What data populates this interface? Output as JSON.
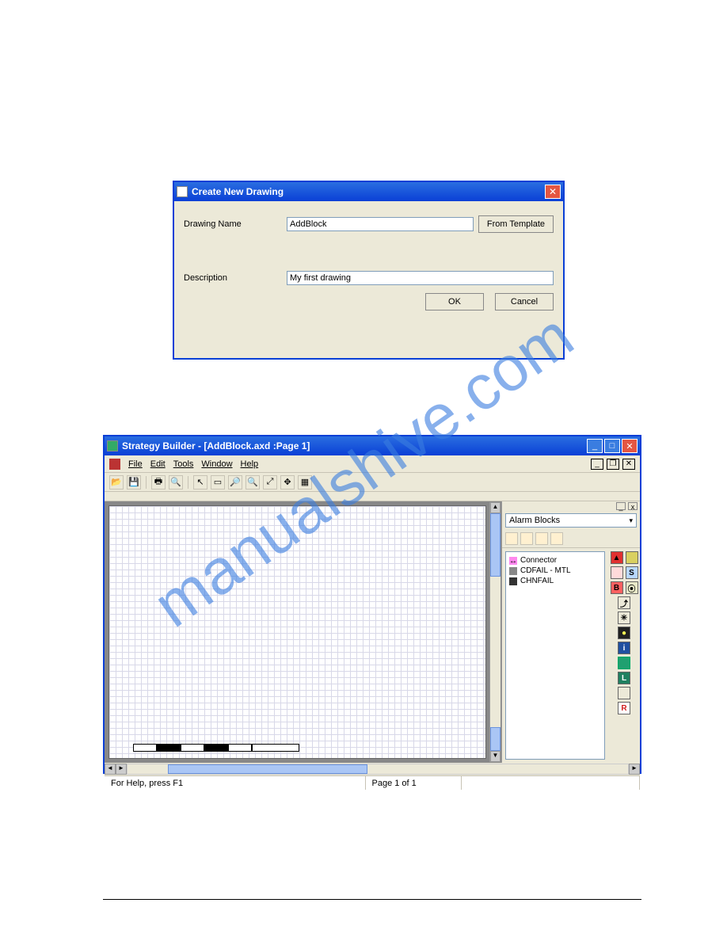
{
  "watermark": "manualshive.com",
  "dialog1": {
    "title": "Create New Drawing",
    "labels": {
      "drawing_name": "Drawing Name",
      "description": "Description"
    },
    "inputs": {
      "drawing_name": "AddBlock",
      "description": "My first drawing"
    },
    "buttons": {
      "from_template": "From Template",
      "ok": "OK",
      "cancel": "Cancel"
    }
  },
  "window2": {
    "title": "Strategy Builder  - [AddBlock.axd :Page 1]",
    "menu": [
      "File",
      "Edit",
      "Tools",
      "Window",
      "Help"
    ],
    "toolbar_icons": [
      "open-icon",
      "save-icon",
      "print-icon",
      "print-preview-icon",
      "pointer-icon",
      "rect-icon",
      "zoom-in-icon",
      "zoom-out-icon",
      "zoom-fit-icon",
      "pan-icon",
      "grid-icon"
    ],
    "panel": {
      "combo_label": "Alarm Blocks",
      "mini_icons": [
        "new-folder-icon",
        "open-folder-icon",
        "disk-icon",
        "disk2-icon"
      ],
      "tree": [
        {
          "icon": "connector-icon",
          "label": "Connector"
        },
        {
          "icon": "block-icon",
          "label": "CDFAIL - MTL"
        },
        {
          "icon": "block-icon",
          "label": "CHNFAIL"
        }
      ],
      "side_tools": {
        "row1": [
          {
            "label": "▲",
            "bg": "#e03030"
          },
          {
            "label": "",
            "bg": "#d9d060"
          }
        ],
        "row2": [
          {
            "label": "",
            "bg": "#ffdada"
          },
          {
            "label": "S",
            "bg": "#b8d8ff"
          }
        ],
        "row3": [
          {
            "label": "B",
            "bg": "#ff6060"
          },
          {
            "label": "⦿",
            "bg": "#e8e8c8"
          }
        ],
        "singles": [
          {
            "label": "⤴",
            "bg": "#ece9d8"
          },
          {
            "label": "✳",
            "bg": "#ece9d8"
          },
          {
            "label": "●",
            "bg": "#202020",
            "fg": "#ff5"
          },
          {
            "label": "i",
            "bg": "#2050a0",
            "fg": "#fff"
          },
          {
            "label": "",
            "bg": "#20a070",
            "border": "#0a6"
          },
          {
            "label": "L",
            "bg": "#208060",
            "fg": "#fff"
          },
          {
            "label": "",
            "bg": "#ece9d8"
          },
          {
            "label": "R",
            "bg": "#fff",
            "fg": "#d02020"
          }
        ]
      }
    },
    "status": {
      "help": "For Help, press F1",
      "page": "Page 1 of 1"
    }
  }
}
